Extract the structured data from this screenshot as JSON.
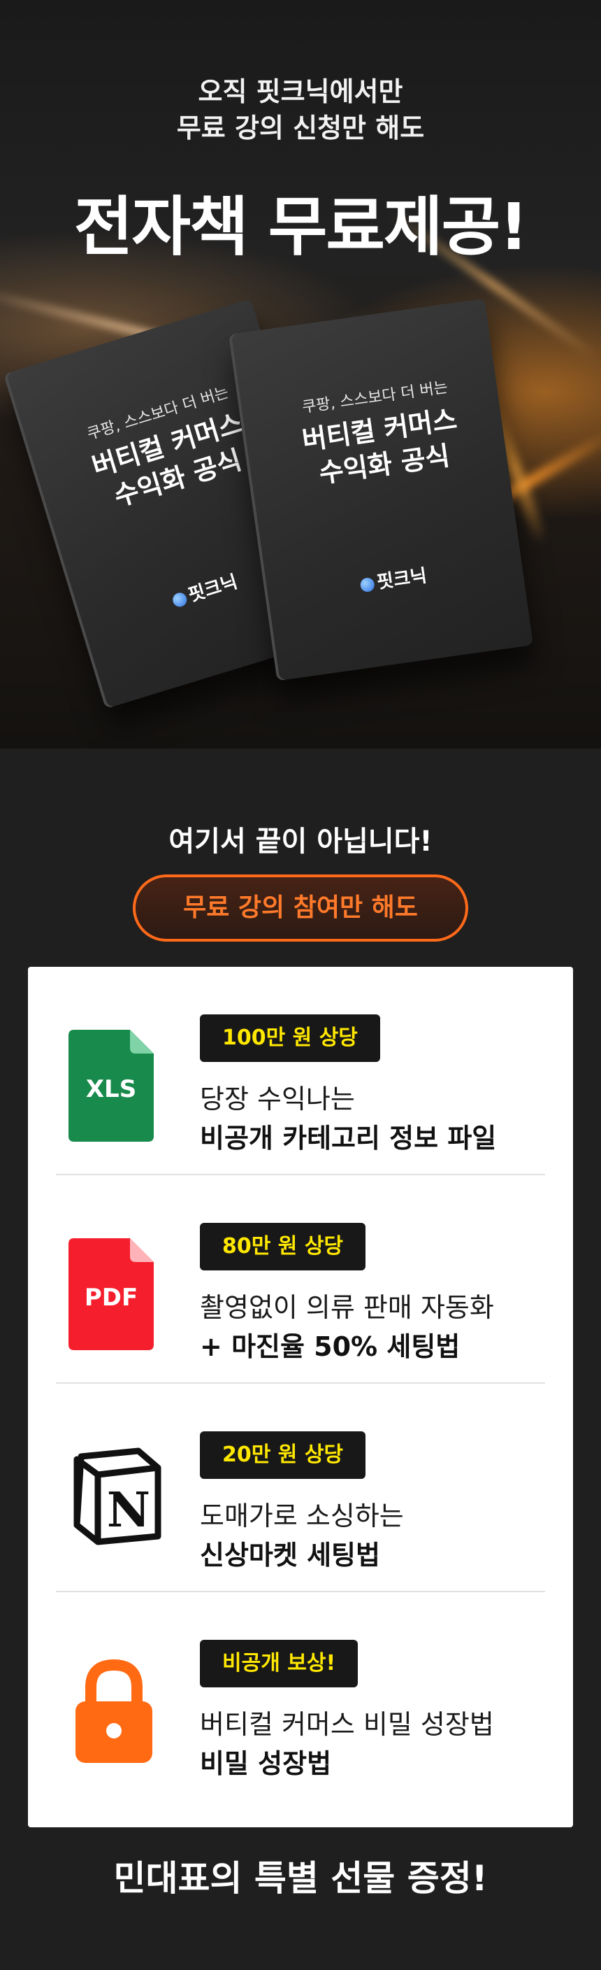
{
  "hero": {
    "line1": "오직 핏크닉에서만",
    "line2": "무료 강의 신청만 해도",
    "title": "전자책 무료제공!"
  },
  "books": [
    {
      "subtitle": "쿠팡, 스스보다 더 버는",
      "title_line1": "버티컬 커머스",
      "title_line2": "수익화 공식",
      "logo": "핏크닉"
    },
    {
      "subtitle": "쿠팡, 스스보다 더 버는",
      "title_line1": "버티컬 커머스",
      "title_line2": "수익화 공식",
      "logo": "핏크닉"
    }
  ],
  "section2": {
    "title": "여기서 끝이 아닙니다!",
    "pill": "무료 강의 참여만 해도"
  },
  "items": [
    {
      "icon": "xls-file-icon",
      "icon_label": "XLS",
      "color": "#178a4c",
      "badge": "100만 원 상당",
      "line1": "당장 수익나는",
      "line2": "비공개 카테고리 정보 파일"
    },
    {
      "icon": "pdf-file-icon",
      "icon_label": "PDF",
      "color": "#f51e2c",
      "badge": "80만 원 상당",
      "line1": "촬영없이 의류 판매 자동화",
      "line2": "+ 마진율 50% 세팅법"
    },
    {
      "icon": "notion-icon",
      "icon_label": "N",
      "color": "#111111",
      "badge": "20만 원 상당",
      "line1": "도매가로 소싱하는",
      "line2": "신상마켓 세팅법"
    },
    {
      "icon": "lock-icon",
      "icon_label": "",
      "color": "#ff6a13",
      "badge": "비공개 보상!",
      "line1": "버티컬 커머스 비밀 성장법",
      "line2": "비밀 성장법"
    }
  ],
  "footer": {
    "title": "민대표의 특별 선물 증정!"
  },
  "colors": {
    "accent_orange": "#ff6a1a",
    "badge_text": "#ffe800"
  }
}
